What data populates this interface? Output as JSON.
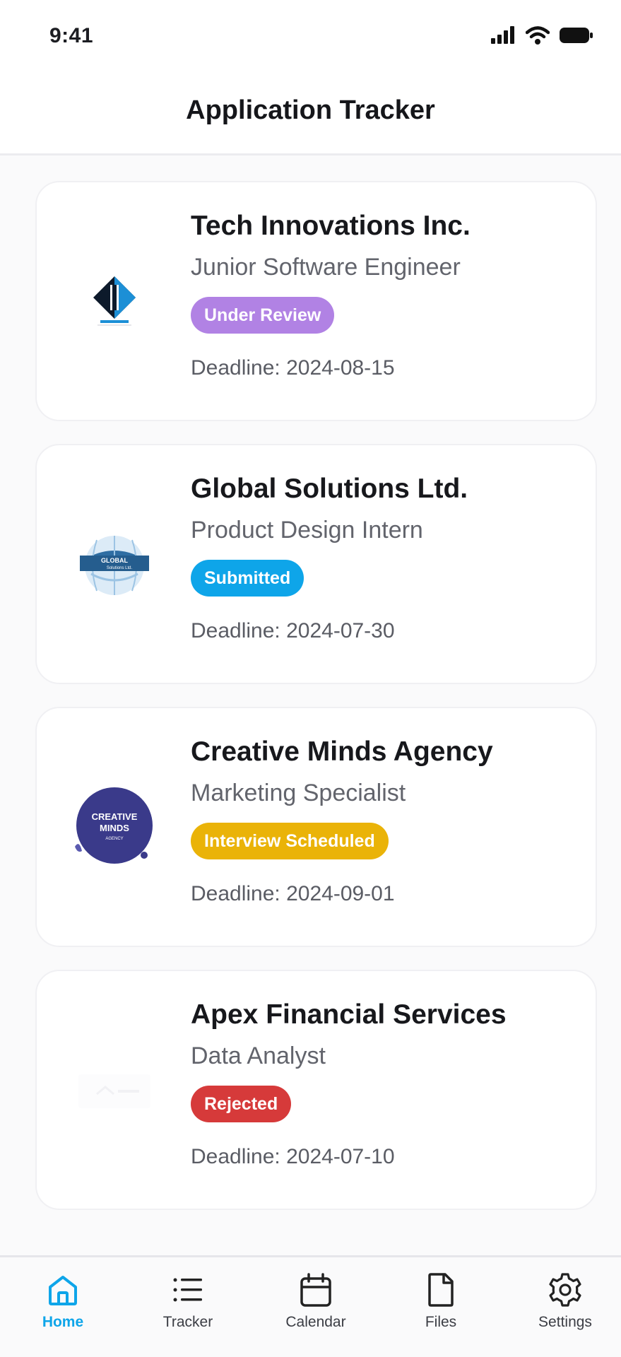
{
  "status_bar": {
    "time": "9:41"
  },
  "header": {
    "title": "Application Tracker"
  },
  "applications": [
    {
      "company": "Tech Innovations Inc.",
      "role": "Junior Software Engineer",
      "status": "Under Review",
      "status_color": "#b182e4",
      "deadline": "Deadline: 2024-08-15",
      "logo_icon": "tech-innovations-logo"
    },
    {
      "company": "Global Solutions Ltd.",
      "role": "Product Design Intern",
      "status": "Submitted",
      "status_color": "#0ea5e9",
      "deadline": "Deadline: 2024-07-30",
      "logo_icon": "global-solutions-logo",
      "logo_text": [
        "GLOBAL",
        "Solutions Ltd."
      ]
    },
    {
      "company": "Creative Minds Agency",
      "role": "Marketing Specialist",
      "status": "Interview Scheduled",
      "status_color": "#eab308",
      "deadline": "Deadline: 2024-09-01",
      "logo_icon": "creative-minds-logo",
      "logo_text": [
        "CREATIVE",
        "MINDS",
        "AGENCY"
      ]
    },
    {
      "company": "Apex Financial Services",
      "role": "Data Analyst",
      "status": "Rejected",
      "status_color": "#d63a3a",
      "deadline": "Deadline: 2024-07-10",
      "logo_icon": "apex-financial-logo"
    }
  ],
  "nav": {
    "items": [
      {
        "label": "Home",
        "icon": "home-icon",
        "active": true
      },
      {
        "label": "Tracker",
        "icon": "list-icon",
        "active": false
      },
      {
        "label": "Calendar",
        "icon": "calendar-icon",
        "active": false
      },
      {
        "label": "Files",
        "icon": "file-icon",
        "active": false
      },
      {
        "label": "Settings",
        "icon": "gear-icon",
        "active": false
      }
    ],
    "active_color": "#0ea5e9"
  }
}
